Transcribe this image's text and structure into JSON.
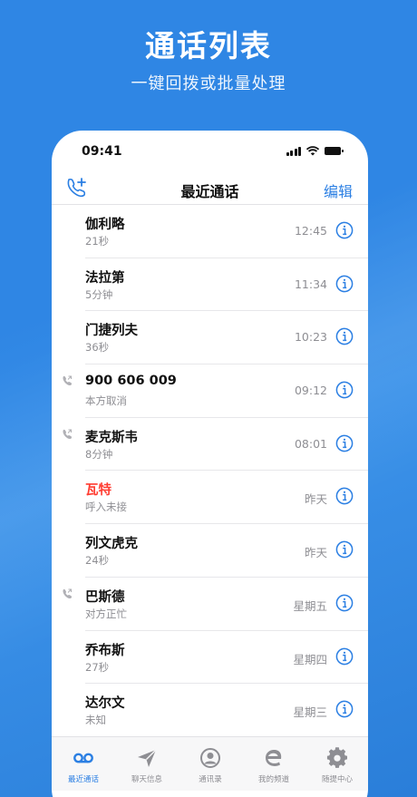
{
  "promo": {
    "title": "通话列表",
    "subtitle": "一键回拨或批量处理"
  },
  "status_bar": {
    "time": "09:41"
  },
  "nav": {
    "title": "最近通话",
    "edit_label": "编辑",
    "add_icon": "phone-plus-icon"
  },
  "calls": [
    {
      "name": "伽利略",
      "detail": "21秒",
      "time": "12:45",
      "missed": false,
      "outgoing": false
    },
    {
      "name": "法拉第",
      "detail": "5分钟",
      "time": "11:34",
      "missed": false,
      "outgoing": false
    },
    {
      "name": "门捷列夫",
      "detail": "36秒",
      "time": "10:23",
      "missed": false,
      "outgoing": false
    },
    {
      "name": "900 606 009",
      "detail": "本方取消",
      "time": "09:12",
      "missed": false,
      "outgoing": true
    },
    {
      "name": "麦克斯韦",
      "detail": "8分钟",
      "time": "08:01",
      "missed": false,
      "outgoing": true
    },
    {
      "name": "瓦特",
      "detail": "呼入未接",
      "time": "昨天",
      "missed": true,
      "outgoing": false
    },
    {
      "name": "列文虎克",
      "detail": "24秒",
      "time": "昨天",
      "missed": false,
      "outgoing": false
    },
    {
      "name": "巴斯德",
      "detail": "对方正忙",
      "time": "星期五",
      "missed": false,
      "outgoing": true
    },
    {
      "name": "乔布斯",
      "detail": "27秒",
      "time": "星期四",
      "missed": false,
      "outgoing": false
    },
    {
      "name": "达尔文",
      "detail": "未知",
      "time": "星期三",
      "missed": false,
      "outgoing": false
    }
  ],
  "tabs": [
    {
      "label": "最近通话",
      "icon": "voicemail-icon",
      "active": true
    },
    {
      "label": "聊天信息",
      "icon": "send-icon",
      "active": false
    },
    {
      "label": "通讯录",
      "icon": "contact-icon",
      "active": false
    },
    {
      "label": "我的频道",
      "icon": "channel-e-icon",
      "active": false
    },
    {
      "label": "随提中心",
      "icon": "gear-icon",
      "active": false
    }
  ],
  "colors": {
    "accent": "#2b7fe3",
    "missed": "#ff3b30",
    "background": "#2f86e4"
  }
}
